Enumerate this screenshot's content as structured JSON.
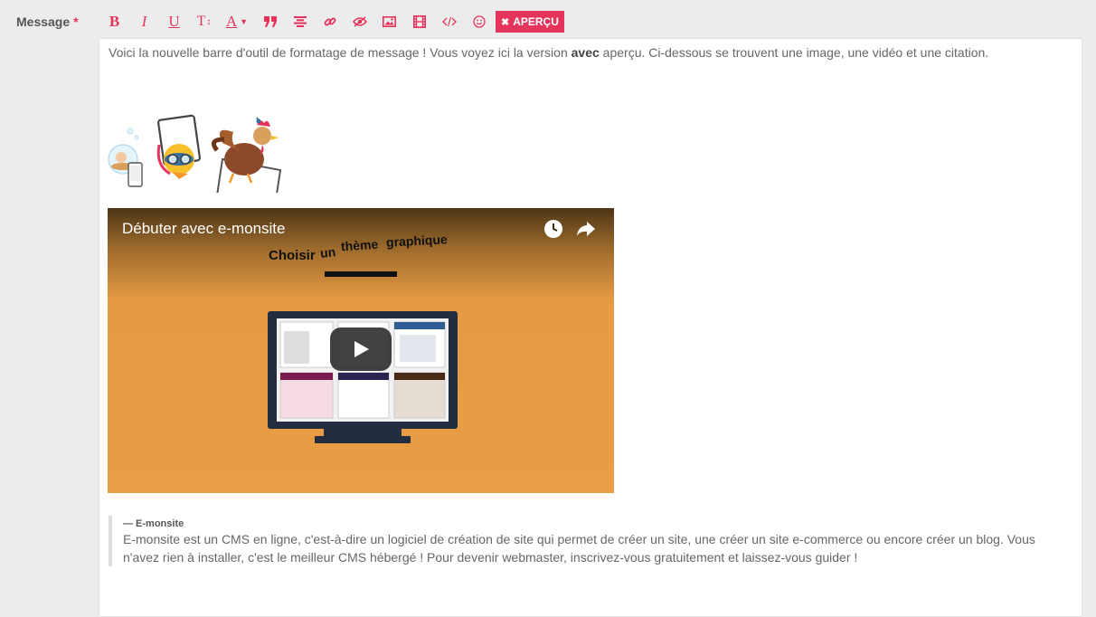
{
  "field": {
    "label": "Message",
    "required_mark": "*"
  },
  "toolbar": {
    "bold": "B",
    "italic": "I",
    "underline": "U",
    "text_size": "T",
    "text_color": "A",
    "icons": [
      "quote-icon",
      "align-center-icon",
      "link-icon",
      "eye-slash-icon",
      "image-icon",
      "film-icon",
      "code-icon",
      "smiley-icon"
    ],
    "preview_label": "APERÇU",
    "accent": "#e5345b"
  },
  "content": {
    "intro_before": "Voici la nouvelle barre d'outil de formatage de message ! Vous voyez ici la version ",
    "intro_bold": "avec",
    "intro_after": " aperçu. Ci-dessous se trouvent une image, une vidéo et une citation.",
    "video": {
      "title": "Débuter avec e-monsite",
      "slide_words": [
        "Choisir",
        "un",
        "thème",
        "graphique"
      ]
    },
    "quote": {
      "author": "— E-monsite",
      "text": "E-monsite est un CMS en ligne, c'est-à-dire un logiciel de création de site qui permet de créer un site, une créer un site e-commerce ou encore créer un blog. Vous n'avez rien à installer, c'est le meilleur CMS hébergé ! Pour devenir webmaster, inscrivez-vous gratuitement et laissez-vous guider !"
    }
  }
}
